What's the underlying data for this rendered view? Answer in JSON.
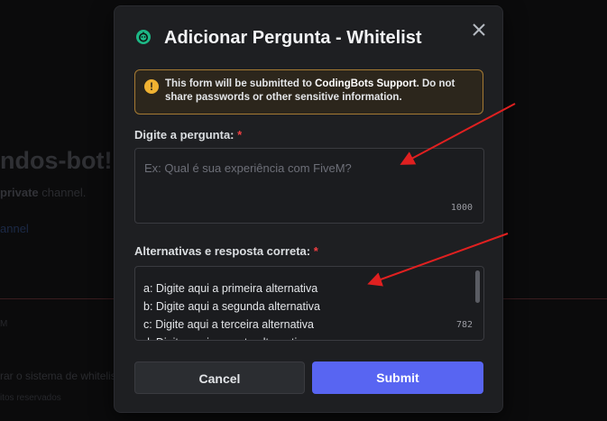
{
  "background": {
    "channel_title": "ndos-bot!",
    "subtitle_bold": "private",
    "subtitle_rest": " channel.",
    "link": "annel",
    "small_label": "M",
    "footer_line1": "rar o sistema de whitelis",
    "footer_line2": "itos reservados"
  },
  "modal": {
    "title": "Adicionar Pergunta - Whitelist",
    "close_icon": "close-icon",
    "bot_icon": "bot-avatar-icon",
    "notice": {
      "prefix": "This form will be submitted to ",
      "app": "CodingBots Support",
      "suffix": ". Do not share passwords or other sensitive information.",
      "icon": "warning-icon",
      "accent": "#f0b232"
    },
    "question": {
      "label": "Digite a pergunta:",
      "required": "*",
      "placeholder": "Ex: Qual é sua experiência com FiveM?",
      "counter": "1000"
    },
    "alternatives": {
      "label": "Alternativas e resposta correta:",
      "required": "*",
      "lines": [
        "a: Digite aqui a primeira alternativa",
        "b: Digite aqui a segunda alternativa",
        "c: Digite aqui a terceira alternativa",
        "d: Digite aqui a quarta alternativa"
      ],
      "counter": "782"
    },
    "buttons": {
      "cancel": "Cancel",
      "submit": "Submit",
      "submit_color": "#5865f2"
    }
  },
  "annotation_color": "#e02020"
}
